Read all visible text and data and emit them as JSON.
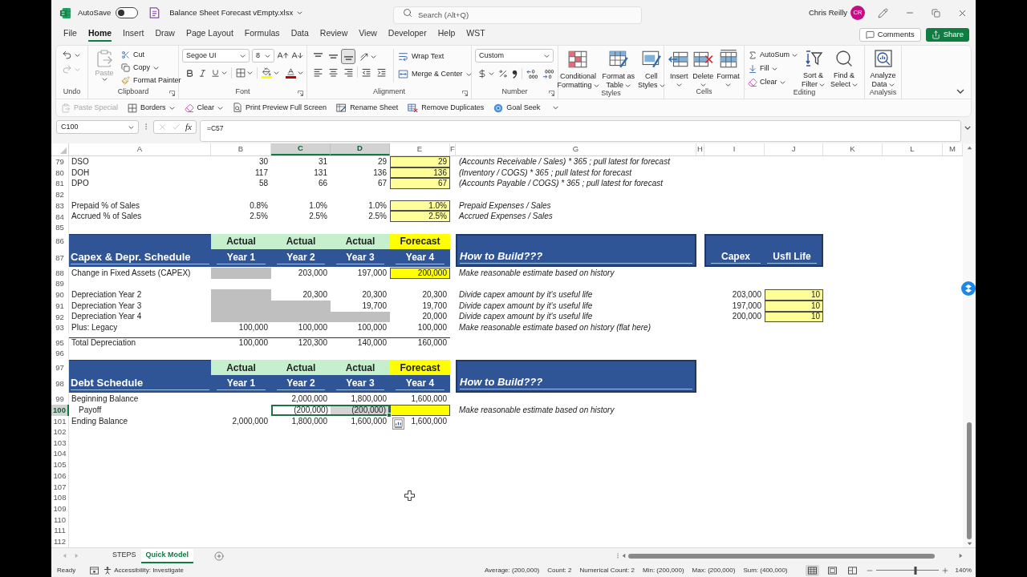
{
  "title_bar": {
    "autosave_label": "AutoSave",
    "autosave_on": false,
    "file_name": "Balance Sheet Forecast vEmpty.xlsx",
    "search_placeholder": "Search (Alt+Q)",
    "user_name": "Chris Reilly",
    "user_initials": "CR"
  },
  "ribbon_tabs": [
    {
      "label": "File",
      "selected": false
    },
    {
      "label": "Home",
      "selected": true
    },
    {
      "label": "Insert",
      "selected": false
    },
    {
      "label": "Draw",
      "selected": false
    },
    {
      "label": "Page Layout",
      "selected": false
    },
    {
      "label": "Formulas",
      "selected": false
    },
    {
      "label": "Data",
      "selected": false
    },
    {
      "label": "Review",
      "selected": false
    },
    {
      "label": "View",
      "selected": false
    },
    {
      "label": "Developer",
      "selected": false
    },
    {
      "label": "Help",
      "selected": false
    },
    {
      "label": "WST",
      "selected": false
    }
  ],
  "ribbon_actions": {
    "comments": "Comments",
    "share": "Share"
  },
  "ribbon": {
    "undo": {
      "label": "Undo",
      "redo_disabled": true
    },
    "clipboard": {
      "label": "Clipboard",
      "paste": "Paste",
      "paste_disabled": true,
      "cut": "Cut",
      "copy": "Copy",
      "format_painter": "Format Painter"
    },
    "font": {
      "label": "Font",
      "family": "Segoe UI",
      "size": "8"
    },
    "alignment": {
      "label": "Alignment",
      "vertical": [
        {
          "kind": "top",
          "selected": false
        },
        {
          "kind": "middle",
          "selected": false
        },
        {
          "kind": "bottom",
          "selected": true
        }
      ],
      "wrap_text": "Wrap Text",
      "merge": "Merge & Center"
    },
    "number": {
      "label": "Number",
      "format": "Custom"
    },
    "styles": {
      "label": "Styles",
      "buttons": [
        {
          "kind": "conditional",
          "lines": [
            "Conditional",
            "Formatting"
          ]
        },
        {
          "kind": "table",
          "lines": [
            "Format as",
            "Table"
          ]
        },
        {
          "kind": "cell_styles",
          "lines": [
            "Cell",
            "Styles"
          ]
        }
      ]
    },
    "cells": {
      "label": "Cells",
      "buttons": [
        {
          "kind": "insert",
          "lines": [
            "Insert"
          ]
        },
        {
          "kind": "delete",
          "lines": [
            "Delete"
          ]
        },
        {
          "kind": "format",
          "lines": [
            "Format"
          ]
        }
      ]
    },
    "editing": {
      "label": "Editing",
      "autosum": "AutoSum",
      "fill": "Fill",
      "clear": "Clear",
      "sort_lines": [
        "Sort &",
        "Filter"
      ],
      "find_lines": [
        "Find &",
        "Select"
      ]
    },
    "analysis": {
      "label": "Analysis",
      "analyze_lines": [
        "Analyze",
        "Data"
      ]
    }
  },
  "quick_access": [
    {
      "kind": "paste",
      "label": "Paste Special",
      "disabled": true,
      "dropdown": false
    },
    {
      "kind": "borders",
      "label": "Borders",
      "disabled": false,
      "dropdown": true
    },
    {
      "kind": "clear",
      "label": "Clear",
      "disabled": false,
      "dropdown": true
    },
    {
      "kind": "preview",
      "label": "Print Preview Full Screen",
      "disabled": false,
      "dropdown": false
    },
    {
      "kind": "rename",
      "label": "Rename Sheet",
      "disabled": false,
      "dropdown": false
    },
    {
      "kind": "dedupe",
      "label": "Remove Duplicates",
      "disabled": false,
      "dropdown": false
    },
    {
      "kind": "goal",
      "label": "Goal Seek",
      "disabled": false,
      "dropdown": false
    }
  ],
  "formula_bar": {
    "name_box": "C100",
    "function_label": "fx",
    "formula": "=C57"
  },
  "columns": [
    {
      "label": "A",
      "selected": false
    },
    {
      "label": "B",
      "selected": false
    },
    {
      "label": "C",
      "selected": true
    },
    {
      "label": "D",
      "selected": true
    },
    {
      "label": "E",
      "selected": false
    },
    {
      "label": "F",
      "selected": false
    },
    {
      "label": "G",
      "selected": false
    },
    {
      "label": "H",
      "selected": false
    },
    {
      "label": "I",
      "selected": false
    },
    {
      "label": "J",
      "selected": false
    },
    {
      "label": "K",
      "selected": false
    },
    {
      "label": "L",
      "selected": false
    },
    {
      "label": "M",
      "selected": false
    }
  ],
  "rows": [
    {
      "kind": "data",
      "number": "79",
      "selected": false,
      "label": "DSO",
      "indented": false,
      "total": false,
      "quick_analysis": false,
      "values": [
        {
          "text": "30",
          "kind": "plain",
          "selected": false
        },
        {
          "text": "31",
          "kind": "plain",
          "selected": false
        },
        {
          "text": "29",
          "kind": "plain",
          "selected": false
        },
        {
          "text": "29",
          "kind": "input",
          "selected": false
        }
      ],
      "note": "(Accounts Receivable / Sales) * 365 ; pull latest for forecast"
    },
    {
      "kind": "data",
      "number": "80",
      "selected": false,
      "label": "DOH",
      "indented": false,
      "total": false,
      "quick_analysis": false,
      "values": [
        {
          "text": "117",
          "kind": "plain",
          "selected": false
        },
        {
          "text": "131",
          "kind": "plain",
          "selected": false
        },
        {
          "text": "136",
          "kind": "plain",
          "selected": false
        },
        {
          "text": "136",
          "kind": "input",
          "selected": false
        }
      ],
      "note": "(Inventory / COGS) * 365 ; pull latest for forecast"
    },
    {
      "kind": "data",
      "number": "81",
      "selected": false,
      "label": "DPO",
      "indented": false,
      "total": false,
      "quick_analysis": false,
      "values": [
        {
          "text": "58",
          "kind": "plain",
          "selected": false
        },
        {
          "text": "66",
          "kind": "plain",
          "selected": false
        },
        {
          "text": "67",
          "kind": "plain",
          "selected": false
        },
        {
          "text": "67",
          "kind": "input",
          "selected": false
        }
      ],
      "note": "(Accounts Payable / COGS) * 365 ; pull latest for forecast"
    },
    {
      "kind": "empty",
      "number": "82",
      "selected": false
    },
    {
      "kind": "data",
      "number": "83",
      "selected": false,
      "label": "Prepaid % of Sales",
      "indented": false,
      "total": false,
      "quick_analysis": false,
      "values": [
        {
          "text": "0.8%",
          "kind": "plain",
          "selected": false
        },
        {
          "text": "1.0%",
          "kind": "plain",
          "selected": false
        },
        {
          "text": "1.0%",
          "kind": "plain",
          "selected": false
        },
        {
          "text": "1.0%",
          "kind": "input",
          "selected": false
        }
      ],
      "note": "Prepaid Expenses / Sales"
    },
    {
      "kind": "data",
      "number": "84",
      "selected": false,
      "label": "Accrued % of Sales",
      "indented": false,
      "total": false,
      "quick_analysis": false,
      "values": [
        {
          "text": "2.5%",
          "kind": "plain",
          "selected": false
        },
        {
          "text": "2.5%",
          "kind": "plain",
          "selected": false
        },
        {
          "text": "2.5%",
          "kind": "plain",
          "selected": false
        },
        {
          "text": "2.5%",
          "kind": "input",
          "selected": false
        }
      ],
      "note": "Accrued Expenses / Sales"
    },
    {
      "kind": "empty",
      "number": "85",
      "selected": false
    },
    {
      "kind": "band",
      "row_numbers": [
        {
          "number": "86",
          "selected": false
        },
        {
          "number": "87",
          "selected": false
        }
      ],
      "title": "Capex & Depr. Schedule",
      "tops": [
        {
          "text": "Actual",
          "kind": "actual"
        },
        {
          "text": "Actual",
          "kind": "actual"
        },
        {
          "text": "Actual",
          "kind": "actual"
        },
        {
          "text": "Forecast",
          "kind": "forecast"
        }
      ],
      "years": [
        "Year 1",
        "Year 2",
        "Year 3",
        "Year 4"
      ],
      "note_title": "How to Build???",
      "side_headers": [
        "Capex",
        "Usfl Life"
      ]
    },
    {
      "kind": "data",
      "number": "88",
      "selected": false,
      "label": "Change in Fixed Assets (CAPEX)",
      "indented": false,
      "total": false,
      "quick_analysis": false,
      "values": [
        {
          "kind": "blank",
          "selected": false
        },
        {
          "text": "203,000",
          "kind": "plain",
          "selected": false
        },
        {
          "text": "197,000",
          "kind": "plain",
          "selected": false
        },
        {
          "text": "200,000",
          "kind": "forecast",
          "selected": false
        }
      ],
      "note": "Make reasonable estimate based on history"
    },
    {
      "kind": "empty",
      "number": "89",
      "selected": false
    },
    {
      "kind": "data",
      "number": "90",
      "selected": false,
      "label": "Depreciation Year 2",
      "indented": false,
      "total": false,
      "quick_analysis": false,
      "values": [
        {
          "kind": "blank",
          "selected": false
        },
        {
          "text": "20,300",
          "kind": "plain",
          "selected": false
        },
        {
          "text": "20,300",
          "kind": "plain",
          "selected": false
        },
        {
          "text": "20,300",
          "kind": "plain",
          "selected": false
        }
      ],
      "note": "Divide capex amount by it's useful life",
      "capex": "203,000",
      "life": {
        "text": "10",
        "kind": "input"
      }
    },
    {
      "kind": "data",
      "number": "91",
      "selected": false,
      "label": "Depreciation Year 3",
      "indented": false,
      "total": false,
      "quick_analysis": false,
      "values": [
        {
          "kind": "blank",
          "selected": false
        },
        {
          "kind": "blank",
          "selected": false
        },
        {
          "text": "19,700",
          "kind": "plain",
          "selected": false
        },
        {
          "text": "19,700",
          "kind": "plain",
          "selected": false
        }
      ],
      "note": "Divide capex amount by it's useful life",
      "capex": "197,000",
      "life": {
        "text": "10",
        "kind": "input"
      }
    },
    {
      "kind": "data",
      "number": "92",
      "selected": false,
      "label": "Depreciation Year 4",
      "indented": false,
      "total": false,
      "quick_analysis": false,
      "values": [
        {
          "kind": "blank",
          "selected": false
        },
        {
          "kind": "blank",
          "selected": false
        },
        {
          "kind": "blank",
          "selected": false
        },
        {
          "text": "20,000",
          "kind": "plain",
          "selected": false
        }
      ],
      "note": "Divide capex amount by it's useful life",
      "capex": "200,000",
      "life": {
        "text": "10",
        "kind": "input"
      }
    },
    {
      "kind": "data",
      "number": "93",
      "selected": false,
      "label": "Plus: Legacy",
      "indented": false,
      "total": false,
      "quick_analysis": false,
      "values": [
        {
          "text": "100,000",
          "kind": "plain",
          "selected": false
        },
        {
          "text": "100,000",
          "kind": "plain",
          "selected": false
        },
        {
          "text": "100,000",
          "kind": "plain",
          "selected": false
        },
        {
          "text": "100,000",
          "kind": "plain",
          "selected": false
        }
      ],
      "note": "Make reasonable estimate based on history (flat here)"
    },
    {
      "kind": "data",
      "number": "95",
      "selected": false,
      "label": "Total Depreciation",
      "indented": false,
      "total": true,
      "quick_analysis": false,
      "values": [
        {
          "text": "100,000",
          "kind": "plain",
          "selected": false
        },
        {
          "text": "120,300",
          "kind": "plain",
          "selected": false
        },
        {
          "text": "140,000",
          "kind": "plain",
          "selected": false
        },
        {
          "text": "160,000",
          "kind": "plain",
          "selected": false
        }
      ]
    },
    {
      "kind": "empty",
      "number": "96",
      "selected": false
    },
    {
      "kind": "band",
      "row_numbers": [
        {
          "number": "97",
          "selected": false
        },
        {
          "number": "98",
          "selected": false
        }
      ],
      "title": "Debt Schedule",
      "tops": [
        {
          "text": "Actual",
          "kind": "actual"
        },
        {
          "text": "Actual",
          "kind": "actual"
        },
        {
          "text": "Actual",
          "kind": "actual"
        },
        {
          "text": "Forecast",
          "kind": "forecast"
        }
      ],
      "years": [
        "Year 1",
        "Year 2",
        "Year 3",
        "Year 4"
      ],
      "note_title": "How to Build???"
    },
    {
      "kind": "data",
      "number": "99",
      "selected": false,
      "label": "Beginning Balance",
      "indented": false,
      "total": false,
      "quick_analysis": false,
      "values": [
        {
          "kind": "plain",
          "selected": false
        },
        {
          "text": "2,000,000",
          "kind": "plain",
          "selected": false
        },
        {
          "text": "1,800,000",
          "kind": "plain",
          "selected": false
        },
        {
          "text": "1,600,000",
          "kind": "plain",
          "selected": false
        }
      ]
    },
    {
      "kind": "data",
      "number": "100",
      "selected": true,
      "label": "Payoff",
      "indented": true,
      "total": false,
      "quick_analysis": false,
      "values": [
        {
          "kind": "plain",
          "selected": false
        },
        {
          "text": "(200,000)",
          "kind": "plain",
          "selected": true
        },
        {
          "text": "(200,000)",
          "kind": "plain",
          "selected": true
        },
        {
          "kind": "forecast",
          "selected": false
        }
      ],
      "note": "Make reasonable estimate based on history"
    },
    {
      "kind": "data",
      "number": "101",
      "selected": false,
      "label": "Ending Balance",
      "indented": false,
      "total": false,
      "quick_analysis": true,
      "values": [
        {
          "text": "2,000,000",
          "kind": "plain",
          "selected": false
        },
        {
          "text": "1,800,000",
          "kind": "plain",
          "selected": false
        },
        {
          "text": "1,600,000",
          "kind": "plain",
          "selected": false
        },
        {
          "text": "1,600,000",
          "kind": "plain",
          "selected": false
        }
      ]
    },
    {
      "kind": "empty",
      "number": "102",
      "selected": false
    },
    {
      "kind": "empty",
      "number": "103",
      "selected": false
    },
    {
      "kind": "empty",
      "number": "104",
      "selected": false
    },
    {
      "kind": "empty",
      "number": "105",
      "selected": false
    },
    {
      "kind": "empty",
      "number": "106",
      "selected": false
    },
    {
      "kind": "empty",
      "number": "107",
      "selected": false
    },
    {
      "kind": "empty",
      "number": "108",
      "selected": false
    },
    {
      "kind": "empty",
      "number": "109",
      "selected": false
    },
    {
      "kind": "empty",
      "number": "110",
      "selected": false
    },
    {
      "kind": "empty",
      "number": "111",
      "selected": false
    },
    {
      "kind": "empty",
      "number": "112",
      "selected": false
    }
  ],
  "sheet_tabs": [
    {
      "label": "STEPS",
      "selected": false
    },
    {
      "label": "Quick Model",
      "selected": true
    }
  ],
  "status_bar": {
    "mode": "Ready",
    "accessibility": "Accessibility: Investigate",
    "stats": [
      "Average: (200,000)",
      "Count: 2",
      "Numerical Count: 2",
      "Min: (200,000)",
      "Max: (200,000)",
      "Sum: (400,000)"
    ],
    "views": [
      {
        "kind": "normal",
        "selected": true
      },
      {
        "kind": "page_layout",
        "selected": false
      },
      {
        "kind": "page_break",
        "selected": false
      }
    ],
    "zoom": {
      "level": 0.64,
      "reading": "140%"
    }
  }
}
